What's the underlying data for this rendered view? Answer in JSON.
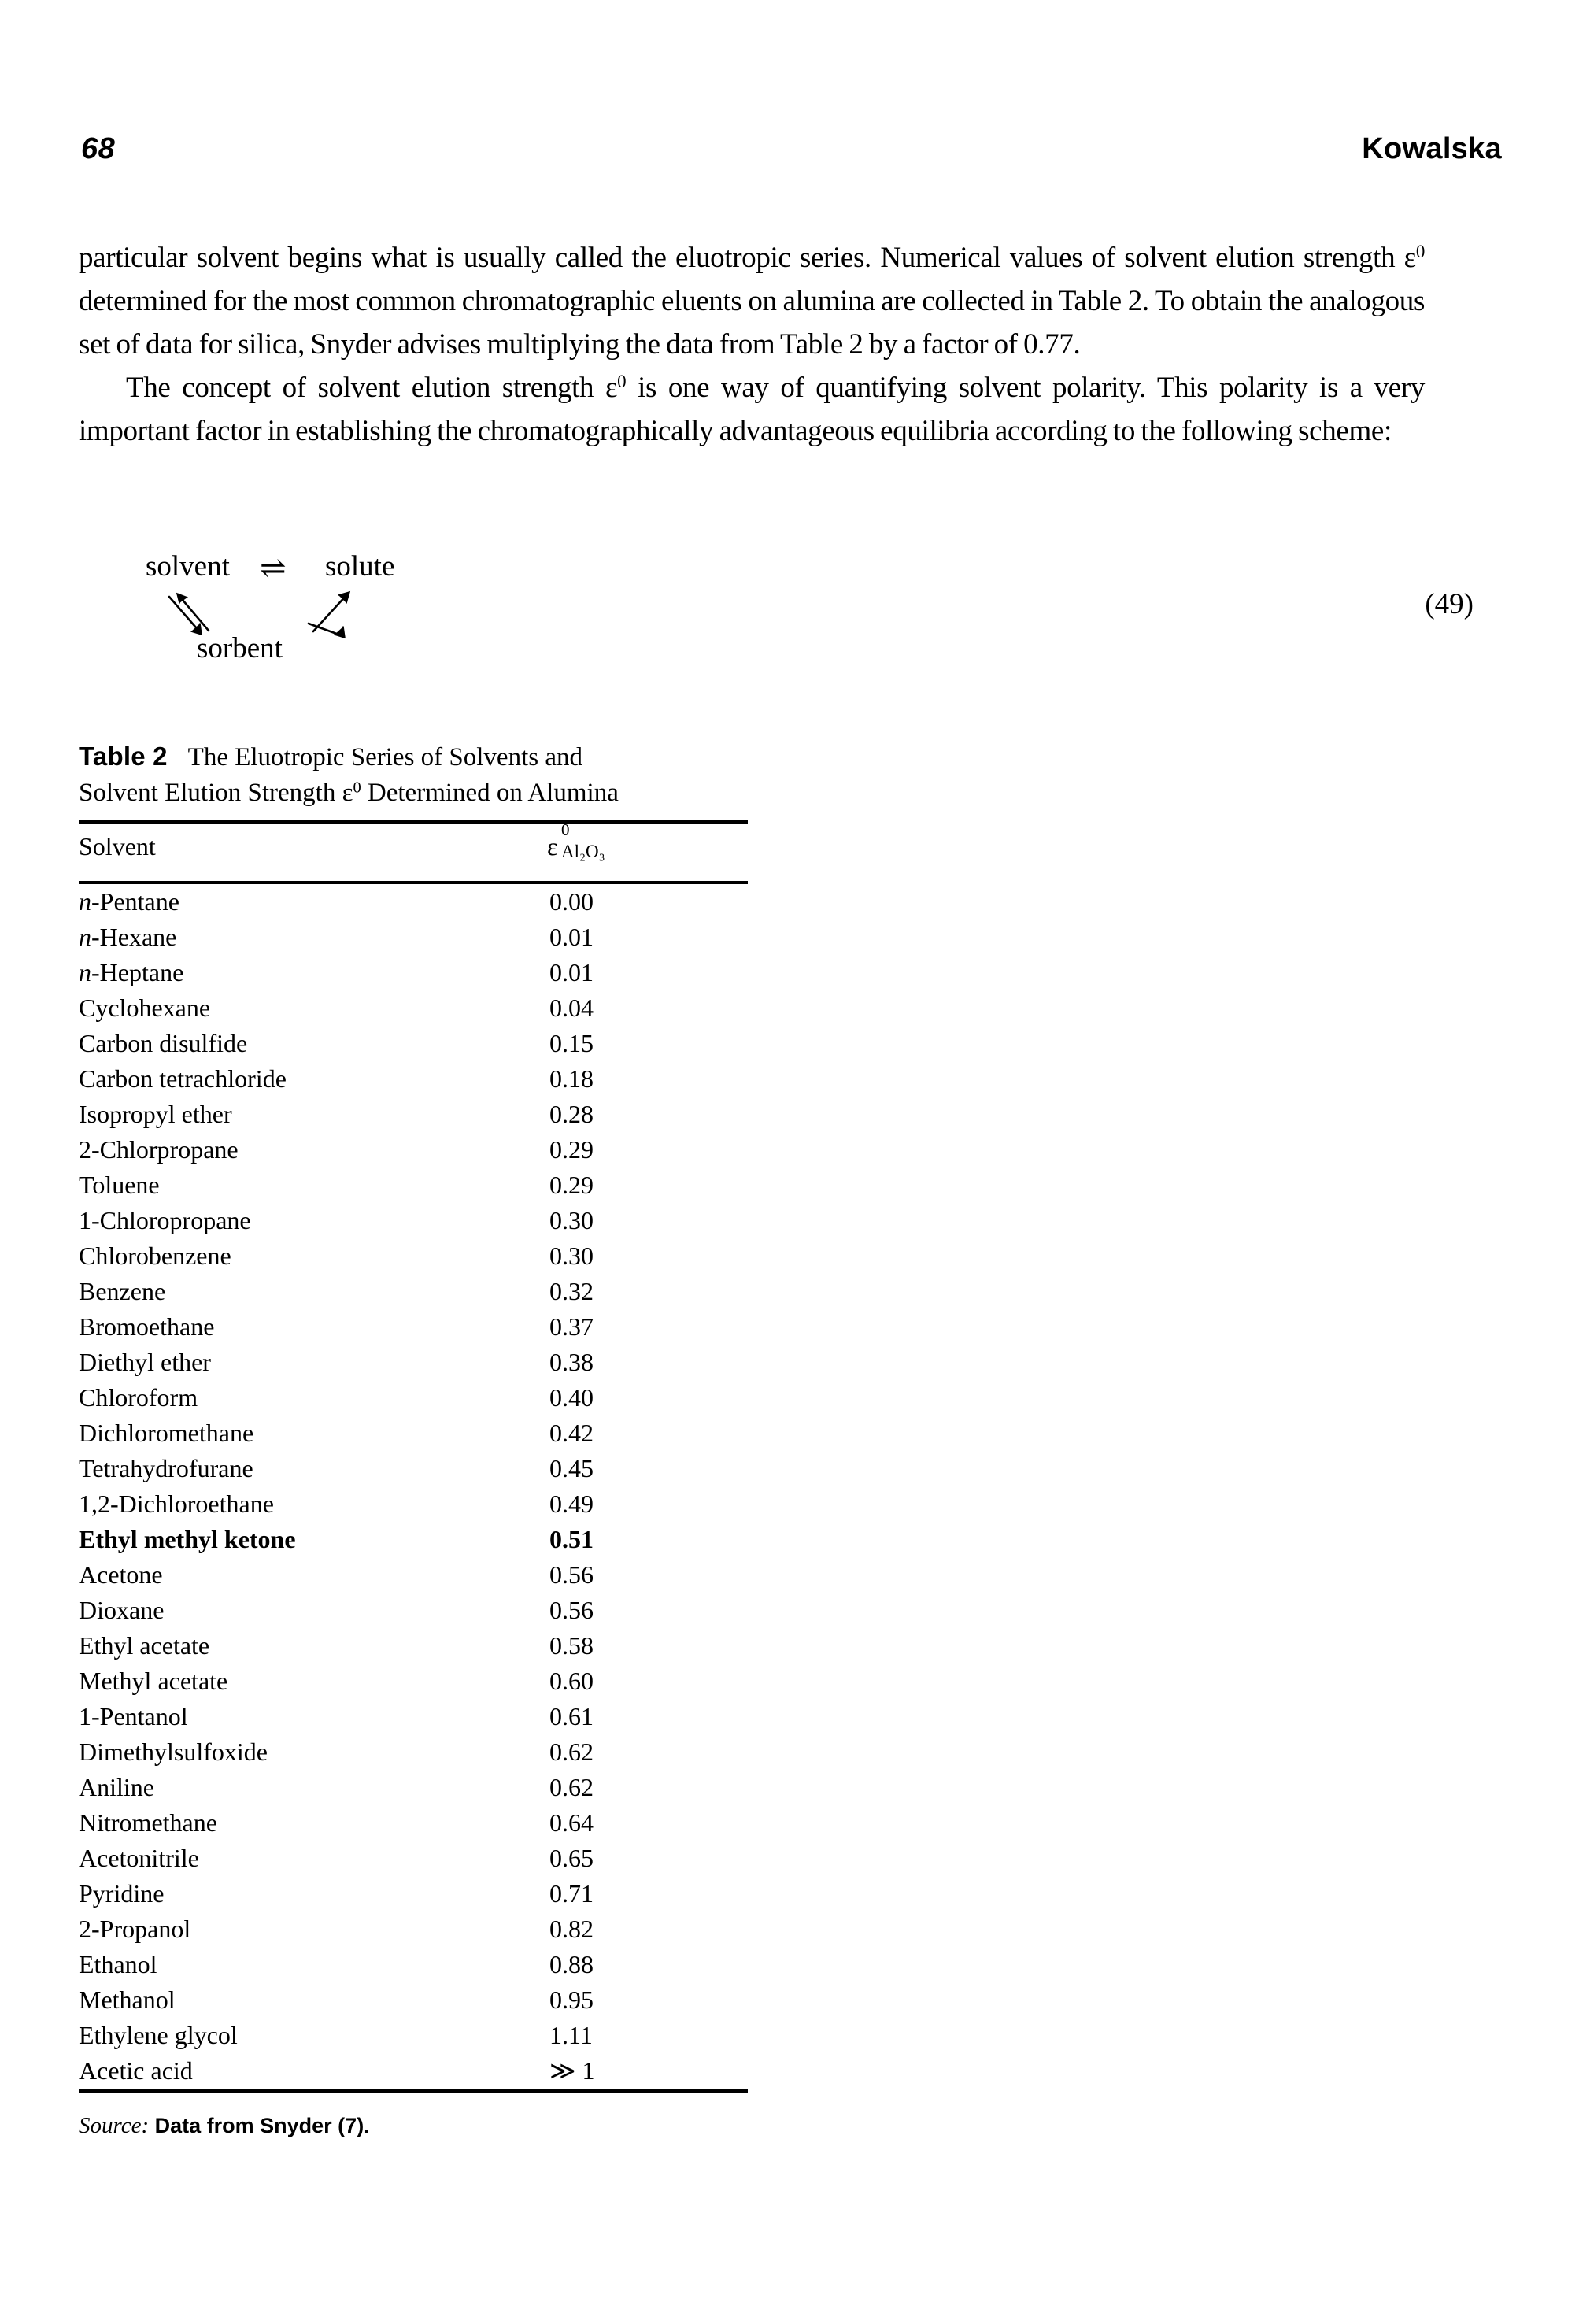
{
  "page": {
    "folio": "68",
    "chapter_title": "Kowalska"
  },
  "body": {
    "paragraph_1_a": "particular solvent begins what is usually called the eluotropic series. Numerical values of solvent elution strength ε",
    "paragraph_1_sup": "0",
    "paragraph_1_b": " determined for the most common chromatographic eluents on alumina are collected in Table 2. To obtain the analogous set of data for silica, Snyder advises multiplying the data from Table 2 by a factor of 0.77.",
    "paragraph_2_a": "The concept of solvent elution strength ε",
    "paragraph_2_sup": "0",
    "paragraph_2_b": " is one way of quantifying solvent polarity. This polarity is a very important factor in establishing the chromatographically advantageous equilibria according to the following scheme:"
  },
  "scheme": {
    "left_species": "solvent",
    "equilibrium_symbol": "⇌",
    "right_species": "solute",
    "bottom_species": "sorbent",
    "equation_number": "(49)"
  },
  "table": {
    "label": "Table 2",
    "caption_line_1": "The Eluotropic Series of Solvents and",
    "caption_line_2_a": "Solvent Elution Strength ε",
    "caption_line_2_sup": "0",
    "caption_line_2_b": " Determined on Alumina",
    "columns": {
      "solvent": "Solvent",
      "value_glyph": "ε",
      "value_superscript": "0",
      "value_subscript": "Al₂O₃"
    },
    "rows": [
      {
        "italic_prefix": "n",
        "name": "-Pentane",
        "value": "0.00",
        "bold": false
      },
      {
        "italic_prefix": "n",
        "name": "-Hexane",
        "value": "0.01",
        "bold": false
      },
      {
        "italic_prefix": "n",
        "name": "-Heptane",
        "value": "0.01",
        "bold": false
      },
      {
        "italic_prefix": "",
        "name": "Cyclohexane",
        "value": "0.04",
        "bold": false
      },
      {
        "italic_prefix": "",
        "name": "Carbon disulfide",
        "value": "0.15",
        "bold": false
      },
      {
        "italic_prefix": "",
        "name": "Carbon tetrachloride",
        "value": "0.18",
        "bold": false
      },
      {
        "italic_prefix": "",
        "name": "Isopropyl ether",
        "value": "0.28",
        "bold": false
      },
      {
        "italic_prefix": "",
        "name": "2-Chlorpropane",
        "value": "0.29",
        "bold": false
      },
      {
        "italic_prefix": "",
        "name": "Toluene",
        "value": "0.29",
        "bold": false
      },
      {
        "italic_prefix": "",
        "name": "1-Chloropropane",
        "value": "0.30",
        "bold": false
      },
      {
        "italic_prefix": "",
        "name": "Chlorobenzene",
        "value": "0.30",
        "bold": false
      },
      {
        "italic_prefix": "",
        "name": "Benzene",
        "value": "0.32",
        "bold": false
      },
      {
        "italic_prefix": "",
        "name": "Bromoethane",
        "value": "0.37",
        "bold": false
      },
      {
        "italic_prefix": "",
        "name": "Diethyl ether",
        "value": "0.38",
        "bold": false
      },
      {
        "italic_prefix": "",
        "name": "Chloroform",
        "value": "0.40",
        "bold": false
      },
      {
        "italic_prefix": "",
        "name": "Dichloromethane",
        "value": "0.42",
        "bold": false
      },
      {
        "italic_prefix": "",
        "name": "Tetrahydrofurane",
        "value": "0.45",
        "bold": false
      },
      {
        "italic_prefix": "",
        "name": "1,2-Dichloroethane",
        "value": "0.49",
        "bold": false
      },
      {
        "italic_prefix": "",
        "name": "Ethyl methyl ketone",
        "value": "0.51",
        "bold": true
      },
      {
        "italic_prefix": "",
        "name": "Acetone",
        "value": "0.56",
        "bold": false
      },
      {
        "italic_prefix": "",
        "name": "Dioxane",
        "value": "0.56",
        "bold": false
      },
      {
        "italic_prefix": "",
        "name": "Ethyl acetate",
        "value": "0.58",
        "bold": false
      },
      {
        "italic_prefix": "",
        "name": "Methyl acetate",
        "value": "0.60",
        "bold": false
      },
      {
        "italic_prefix": "",
        "name": "1-Pentanol",
        "value": "0.61",
        "bold": false
      },
      {
        "italic_prefix": "",
        "name": "Dimethylsulfoxide",
        "value": "0.62",
        "bold": false
      },
      {
        "italic_prefix": "",
        "name": "Aniline",
        "value": "0.62",
        "bold": false
      },
      {
        "italic_prefix": "",
        "name": "Nitromethane",
        "value": "0.64",
        "bold": false
      },
      {
        "italic_prefix": "",
        "name": "Acetonitrile",
        "value": "0.65",
        "bold": false
      },
      {
        "italic_prefix": "",
        "name": "Pyridine",
        "value": "0.71",
        "bold": false
      },
      {
        "italic_prefix": "",
        "name": "2-Propanol",
        "value": "0.82",
        "bold": false
      },
      {
        "italic_prefix": "",
        "name": "Ethanol",
        "value": "0.88",
        "bold": false
      },
      {
        "italic_prefix": "",
        "name": "Methanol",
        "value": "0.95",
        "bold": false
      },
      {
        "italic_prefix": "",
        "name": "Ethylene glycol",
        "value": "1.11",
        "bold": false
      },
      {
        "italic_prefix": "",
        "name": "Acetic acid",
        "value": "≫ 1",
        "bold": false
      }
    ],
    "source_label": "Source:",
    "source_text": " Data from Snyder (7)."
  }
}
